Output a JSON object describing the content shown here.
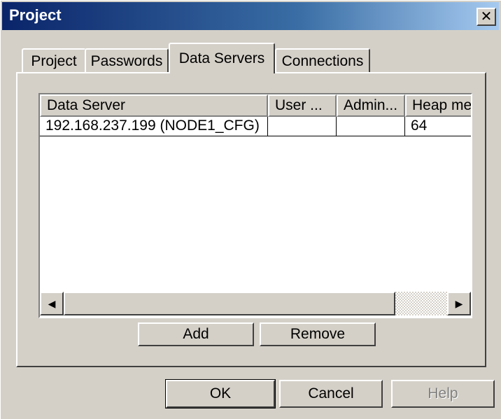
{
  "window": {
    "title": "Project"
  },
  "tabs": [
    {
      "label": "Project",
      "active": false
    },
    {
      "label": "Passwords",
      "active": false
    },
    {
      "label": "Data Servers",
      "active": true
    },
    {
      "label": "Connections",
      "active": false
    }
  ],
  "list": {
    "columns": [
      "Data Server",
      "User ...",
      "Admin...",
      "Heap me"
    ],
    "rows": [
      [
        "192.168.237.199 (NODE1_CFG)",
        "",
        "",
        "64"
      ]
    ]
  },
  "panel_buttons": {
    "add": "Add",
    "remove": "Remove"
  },
  "dialog_buttons": {
    "ok": "OK",
    "cancel": "Cancel",
    "help": "Help"
  },
  "scrollbar": {
    "left_arrow": "◀",
    "right_arrow": "▶"
  }
}
